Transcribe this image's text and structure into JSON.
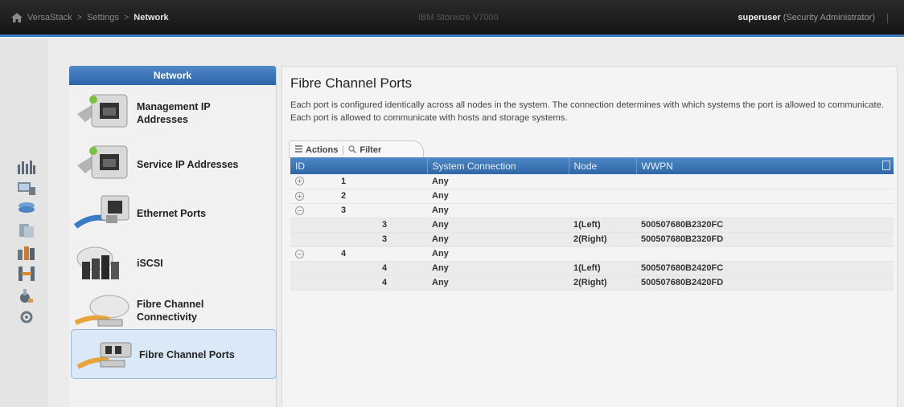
{
  "header": {
    "breadcrumb": [
      "VersaStack",
      "Settings",
      "Network"
    ],
    "separator": ">",
    "system_name": "IBM Storwize V7000",
    "user_name": "superuser",
    "user_role": "(Security Administrator)"
  },
  "nav": {
    "title": "Network",
    "items": [
      {
        "label_line1": "Management IP",
        "label_line2": "Addresses"
      },
      {
        "label_line1": "Service IP Addresses",
        "label_line2": ""
      },
      {
        "label_line1": "Ethernet Ports",
        "label_line2": ""
      },
      {
        "label_line1": "iSCSI",
        "label_line2": ""
      },
      {
        "label_line1": "Fibre Channel",
        "label_line2": "Connectivity"
      },
      {
        "label_line1": "Fibre Channel Ports",
        "label_line2": ""
      }
    ],
    "selected_index": 5
  },
  "main": {
    "title": "Fibre Channel Ports",
    "description": "Each port is configured identically across all nodes in the system. The connection determines with which systems the port is allowed to communicate. Each port is allowed to communicate with hosts and storage systems.",
    "toolbar": {
      "actions_label": "Actions",
      "filter_label": "Filter"
    },
    "columns": [
      "ID",
      "System Connection",
      "Node",
      "WWPN"
    ],
    "rows": [
      {
        "kind": "group",
        "state": "collapsed",
        "id": "1",
        "connection": "Any",
        "node": "",
        "wwpn": ""
      },
      {
        "kind": "group",
        "state": "collapsed",
        "id": "2",
        "connection": "Any",
        "node": "",
        "wwpn": ""
      },
      {
        "kind": "group",
        "state": "expanded",
        "id": "3",
        "connection": "Any",
        "node": "",
        "wwpn": ""
      },
      {
        "kind": "child",
        "id": "3",
        "connection": "Any",
        "node": "1(Left)",
        "wwpn": "500507680B2320FC"
      },
      {
        "kind": "child",
        "id": "3",
        "connection": "Any",
        "node": "2(Right)",
        "wwpn": "500507680B2320FD"
      },
      {
        "kind": "group",
        "state": "expanded",
        "id": "4",
        "connection": "Any",
        "node": "",
        "wwpn": ""
      },
      {
        "kind": "child",
        "id": "4",
        "connection": "Any",
        "node": "1(Left)",
        "wwpn": "500507680B2420FC"
      },
      {
        "kind": "child",
        "id": "4",
        "connection": "Any",
        "node": "2(Right)",
        "wwpn": "500507680B2420FD"
      }
    ]
  },
  "rail_icons": [
    "monitoring-icon",
    "pools-icon",
    "volumes-icon",
    "hosts-icon",
    "copy-services-icon",
    "access-icon",
    "settings-icon",
    "lock-icon"
  ],
  "colors": {
    "accent": "#3b7cc4",
    "header_bg": "#1c1c1c",
    "table_header": "#3a72b4"
  }
}
